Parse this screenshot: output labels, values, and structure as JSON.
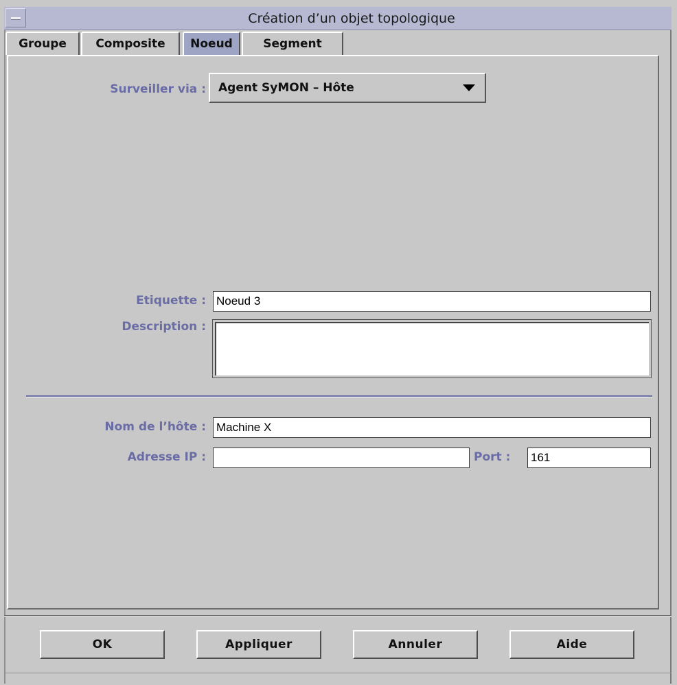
{
  "window": {
    "title": "Création d’un objet topologique"
  },
  "tabs": [
    {
      "label": "Groupe",
      "selected": false
    },
    {
      "label": "Composite",
      "selected": false
    },
    {
      "label": "Noeud",
      "selected": true
    },
    {
      "label": "Segment",
      "selected": false
    }
  ],
  "form": {
    "monitor_via_label": "Surveiller via :",
    "monitor_via_value": "Agent SyMON – Hôte",
    "label_label": "Etiquette :",
    "label_value": "Noeud 3",
    "description_label": "Description :",
    "description_value": "",
    "hostname_label": "Nom de l’hôte :",
    "hostname_value": "Machine X",
    "ip_label": "Adresse IP :",
    "ip_value": "",
    "port_label": "Port :",
    "port_value": "161"
  },
  "buttons": {
    "ok": "OK",
    "apply": "Appliquer",
    "cancel": "Annuler",
    "help": "Aide"
  },
  "colors": {
    "background": "#c8c8c8",
    "titlebar": "#b7b9d3",
    "label_text": "#6a6ca6",
    "selected_tab": "#9ea5c4"
  }
}
